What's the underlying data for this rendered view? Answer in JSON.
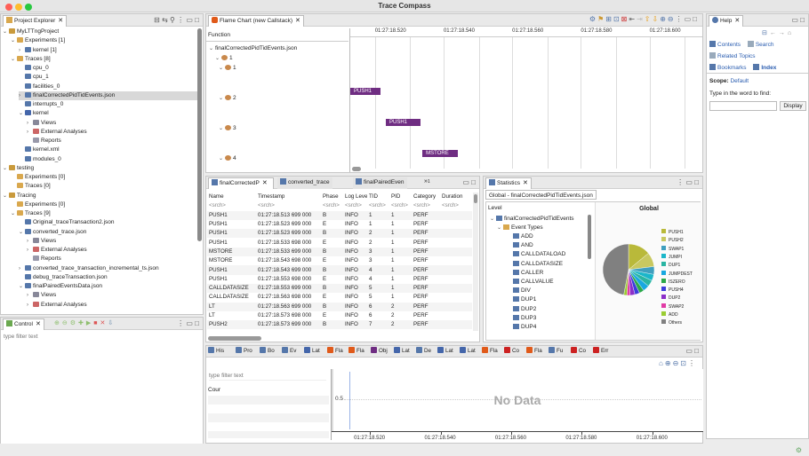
{
  "window": {
    "title": "Trace Compass"
  },
  "project_explorer": {
    "tab_label": "Project Explorer",
    "items": [
      {
        "label": "MyLTTngProject",
        "level": 0,
        "exp": "v",
        "icon": "project"
      },
      {
        "label": "Experiments [1]",
        "level": 1,
        "exp": "v",
        "icon": "folder"
      },
      {
        "label": "kernel [1]",
        "level": 2,
        "exp": ">",
        "icon": "exp"
      },
      {
        "label": "Traces [8]",
        "level": 1,
        "exp": "v",
        "icon": "folder"
      },
      {
        "label": "cpu_0",
        "level": 2,
        "exp": "",
        "icon": "file"
      },
      {
        "label": "cpu_1",
        "level": 2,
        "exp": "",
        "icon": "file"
      },
      {
        "label": "facilities_0",
        "level": 2,
        "exp": "",
        "icon": "file"
      },
      {
        "label": "finalCorrectedPidTidEvents.json",
        "level": 2,
        "exp": ">",
        "icon": "file",
        "selected": true
      },
      {
        "label": "interrupts_0",
        "level": 2,
        "exp": "",
        "icon": "file"
      },
      {
        "label": "kernel",
        "level": 2,
        "exp": "v",
        "icon": "kernel"
      },
      {
        "label": "Views",
        "level": 3,
        "exp": ">",
        "icon": "views"
      },
      {
        "label": "External Analyses",
        "level": 3,
        "exp": ">",
        "icon": "ext"
      },
      {
        "label": "Reports",
        "level": 3,
        "exp": "",
        "icon": "rep"
      },
      {
        "label": "kernel.xml",
        "level": 2,
        "exp": "",
        "icon": "file"
      },
      {
        "label": "modules_0",
        "level": 2,
        "exp": "",
        "icon": "file"
      },
      {
        "label": "testing",
        "level": 0,
        "exp": "v",
        "icon": "project"
      },
      {
        "label": "Experiments [0]",
        "level": 1,
        "exp": "",
        "icon": "folder"
      },
      {
        "label": "Traces [0]",
        "level": 1,
        "exp": "",
        "icon": "folder"
      },
      {
        "label": "Tracing",
        "level": 0,
        "exp": "v",
        "icon": "project"
      },
      {
        "label": "Experiments [0]",
        "level": 1,
        "exp": "",
        "icon": "folder"
      },
      {
        "label": "Traces [9]",
        "level": 1,
        "exp": "v",
        "icon": "folder"
      },
      {
        "label": "Original_traceTransaction2.json",
        "level": 2,
        "exp": "",
        "icon": "file"
      },
      {
        "label": "converted_trace.json",
        "level": 2,
        "exp": "v",
        "icon": "file"
      },
      {
        "label": "Views",
        "level": 3,
        "exp": ">",
        "icon": "views"
      },
      {
        "label": "External Analyses",
        "level": 3,
        "exp": ">",
        "icon": "ext"
      },
      {
        "label": "Reports",
        "level": 3,
        "exp": "",
        "icon": "rep"
      },
      {
        "label": "converted_trace_transaction_incremental_ts.json",
        "level": 2,
        "exp": ">",
        "icon": "file"
      },
      {
        "label": "debug_traceTransaction.json",
        "level": 2,
        "exp": "",
        "icon": "file"
      },
      {
        "label": "finalPairedEventsData.json",
        "level": 2,
        "exp": "v",
        "icon": "file"
      },
      {
        "label": "Views",
        "level": 3,
        "exp": ">",
        "icon": "views"
      },
      {
        "label": "External Analyses",
        "level": 3,
        "exp": ">",
        "icon": "ext"
      },
      {
        "label": "Reports",
        "level": 3,
        "exp": "",
        "icon": "rep"
      }
    ]
  },
  "control": {
    "tab_label": "Control",
    "filter_placeholder": "type filter text"
  },
  "flame_chart": {
    "tab_label": "Flame Chart (new Callstack)",
    "column_header": "Function",
    "root": "finalCorrectedPidTidEvents.json",
    "threads": [
      "1",
      "2",
      "3",
      "4"
    ],
    "time_labels": [
      "01:27:18.520",
      "01:27:18.540",
      "01:27:18.560",
      "01:27:18.580",
      "01:27:18.600"
    ],
    "events": [
      {
        "label": "PUSH1",
        "row": 0,
        "start": 0.0,
        "end": 0.085
      },
      {
        "label": "PUSH1",
        "row": 1,
        "start": 0.101,
        "end": 0.2
      },
      {
        "label": "MSTORE",
        "row": 2,
        "start": 0.205,
        "end": 0.305
      }
    ]
  },
  "events_table": {
    "tabs": [
      "finalCorrectedP",
      "converted_trace",
      "finalPairedEven"
    ],
    "overflow_count": "1",
    "columns": [
      "Name",
      "Timestamp",
      "Phase",
      "Log Level",
      "TID",
      "PID",
      "Category",
      "Duration"
    ],
    "search_row": [
      "<srch>",
      "<srch>",
      "<srch>",
      "<srch>",
      "<srch>",
      "<srch>",
      "<srch>",
      "<srch>"
    ],
    "rows": [
      [
        "PUSH1",
        "01:27:18.513 699 000",
        "B",
        "INFO",
        "1",
        "1",
        "PERF",
        ""
      ],
      [
        "PUSH1",
        "01:27:18.523 699 000",
        "E",
        "INFO",
        "1",
        "1",
        "PERF",
        ""
      ],
      [
        "PUSH1",
        "01:27:18.523 699 000",
        "B",
        "INFO",
        "2",
        "1",
        "PERF",
        ""
      ],
      [
        "PUSH1",
        "01:27:18.533 698 000",
        "E",
        "INFO",
        "2",
        "1",
        "PERF",
        ""
      ],
      [
        "MSTORE",
        "01:27:18.533 699 000",
        "B",
        "INFO",
        "3",
        "1",
        "PERF",
        ""
      ],
      [
        "MSTORE",
        "01:27:18.543 698 000",
        "E",
        "INFO",
        "3",
        "1",
        "PERF",
        ""
      ],
      [
        "PUSH1",
        "01:27:18.543 699 000",
        "B",
        "INFO",
        "4",
        "1",
        "PERF",
        ""
      ],
      [
        "PUSH1",
        "01:27:18.553 698 000",
        "E",
        "INFO",
        "4",
        "1",
        "PERF",
        ""
      ],
      [
        "CALLDATASIZE",
        "01:27:18.553 699 000",
        "B",
        "INFO",
        "5",
        "1",
        "PERF",
        ""
      ],
      [
        "CALLDATASIZE",
        "01:27:18.563 698 000",
        "E",
        "INFO",
        "5",
        "1",
        "PERF",
        ""
      ],
      [
        "LT",
        "01:27:18.563 699 000",
        "B",
        "INFO",
        "6",
        "2",
        "PERF",
        ""
      ],
      [
        "LT",
        "01:27:18.573 698 000",
        "E",
        "INFO",
        "6",
        "2",
        "PERF",
        ""
      ],
      [
        "PUSH2",
        "01:27:18.573 699 000",
        "B",
        "INFO",
        "7",
        "2",
        "PERF",
        ""
      ]
    ]
  },
  "statistics": {
    "tab_label": "Statistics",
    "subtab": "Global - finalCorrectedPidTidEvents.json",
    "level_header": "Level",
    "root": "finalCorrectedPidTidEvents",
    "event_types_label": "Event Types",
    "event_types": [
      "ADD",
      "AND",
      "CALLDATALOAD",
      "CALLDATASIZE",
      "CALLER",
      "CALLVALUE",
      "DIV",
      "DUP1",
      "DUP2",
      "DUP3",
      "DUP4"
    ],
    "chart_title": "Global",
    "chart_data": {
      "type": "pie",
      "title": "Global",
      "categories": [
        "PUSH1",
        "PUSH2",
        "SWAP1",
        "JUMPI",
        "DUP1",
        "JUMPDEST",
        "ISZERO",
        "PUSH4",
        "DUP2",
        "SWAP2",
        "ADD",
        "Others"
      ],
      "values": [
        14,
        9,
        5,
        4,
        4,
        4,
        3,
        3,
        3,
        2,
        2,
        47
      ],
      "colors": [
        "#b9b93a",
        "#c8c860",
        "#3f9fbf",
        "#1bb6c9",
        "#2ab5a3",
        "#18a8e0",
        "#2ca84a",
        "#3d3ddc",
        "#8b2fc9",
        "#e13ba5",
        "#9acd32",
        "#808080"
      ]
    }
  },
  "help": {
    "tab_label": "Help",
    "contents": "Contents",
    "search": "Search",
    "related": "Related Topics",
    "bookmarks": "Bookmarks",
    "index": "Index",
    "scope_label": "Scope:",
    "scope_value": "Default",
    "type_prompt": "Type in the word to find:",
    "display_button": "Display"
  },
  "bottom": {
    "tabs": [
      "His",
      "Pro",
      "Bo",
      "Ev",
      "Lat",
      "Fla",
      "Fla",
      "Obj",
      "Lat",
      "De",
      "Lat",
      "Lat",
      "Fla",
      "Co",
      "Fla",
      "Fu",
      "Co",
      "Err"
    ],
    "tab_colors": [
      "#5577aa",
      "#5577aa",
      "#5577aa",
      "#5577aa",
      "#4466aa",
      "#e05a1a",
      "#e05a1a",
      "#6f2d82",
      "#4466aa",
      "#5577aa",
      "#4466aa",
      "#4466aa",
      "#e05a1a",
      "#cc2222",
      "#e05a1a",
      "#5577aa",
      "#cc2222",
      "#cc2222"
    ],
    "filter_placeholder": "type filter text",
    "count_header": "Cour",
    "y_tick": "0.5",
    "no_data": "No Data",
    "time_labels": [
      "01:27:18.520",
      "01:27:18.540",
      "01:27:18.560",
      "01:27:18.580",
      "01:27:18.600"
    ]
  }
}
